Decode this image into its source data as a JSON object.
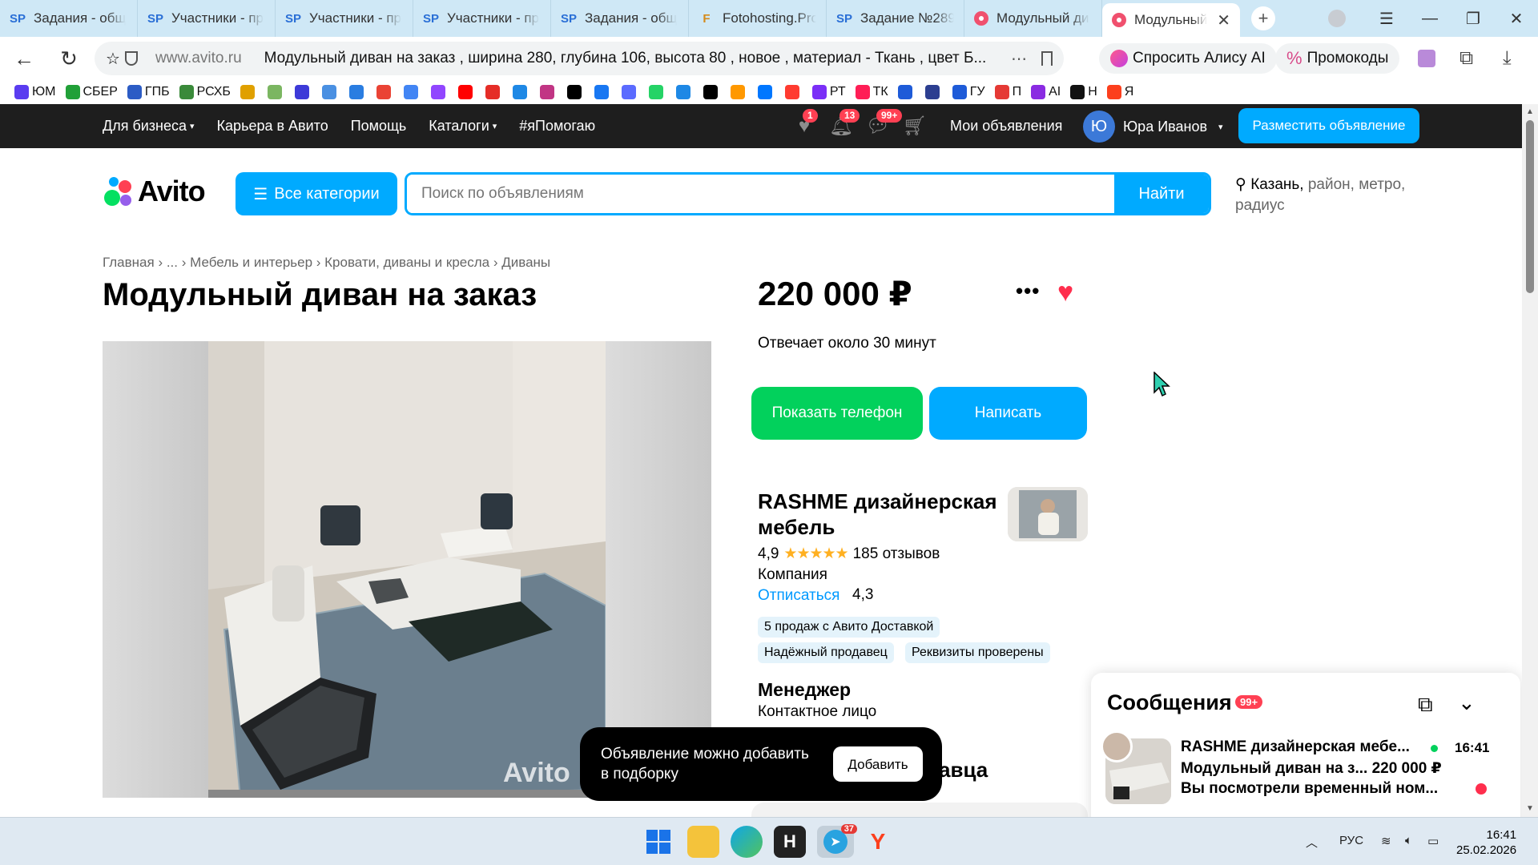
{
  "browser": {
    "tabs": [
      {
        "icon": "SP",
        "label": "Задания - общ"
      },
      {
        "icon": "SP",
        "label": "Участники - пр"
      },
      {
        "icon": "SP",
        "label": "Участники - пр"
      },
      {
        "icon": "SP",
        "label": "Участники - пр"
      },
      {
        "icon": "SP",
        "label": "Задания - общ"
      },
      {
        "icon": "F",
        "label": "Fotohosting.Pro"
      },
      {
        "icon": "SP",
        "label": "Задание №289"
      },
      {
        "icon": "",
        "label": "Модульный ди"
      },
      {
        "icon": "",
        "label": "Модульный"
      }
    ],
    "address": {
      "rating": "4,3",
      "host": "www.avito.ru",
      "page_title": "Модульный диван на заказ , ширина 280, глубина 106, высота 80 , новое , материал - Ткань , цвет Б..."
    },
    "alice_label": "Спросить Алису AI",
    "promo_label": "Промокоды",
    "bookmarks": [
      {
        "label": "ЮМ",
        "color": "#5a3cf0"
      },
      {
        "label": "СБЕР",
        "color": "#21a038"
      },
      {
        "label": "ГПБ",
        "color": "#2c5cc5"
      },
      {
        "label": "РСХБ",
        "color": "#3a8a3a"
      },
      {
        "label": "",
        "color": "#e0a000"
      },
      {
        "label": "",
        "color": "#7bb661"
      },
      {
        "label": "",
        "color": "#3d3ad8"
      },
      {
        "label": "",
        "color": "#4a90e2"
      },
      {
        "label": "",
        "color": "#2a7de1"
      },
      {
        "label": "",
        "color": "#ea4335"
      },
      {
        "label": "",
        "color": "#4285f4"
      },
      {
        "label": "",
        "color": "#9146ff"
      },
      {
        "label": "",
        "color": "#ff0000"
      },
      {
        "label": "",
        "color": "#e52d27"
      },
      {
        "label": "",
        "color": "#1e88e5"
      },
      {
        "label": "",
        "color": "#c13584"
      },
      {
        "label": "",
        "color": "#000000"
      },
      {
        "label": "",
        "color": "#1877f2"
      },
      {
        "label": "",
        "color": "#5b6bff"
      },
      {
        "label": "",
        "color": "#25d366"
      },
      {
        "label": "",
        "color": "#1e88e5"
      },
      {
        "label": "",
        "color": "#000000"
      },
      {
        "label": "",
        "color": "#ff9800"
      },
      {
        "label": "",
        "color": "#0077ff"
      },
      {
        "label": "",
        "color": "#ff3b30"
      },
      {
        "label": "РТ",
        "color": "#7b2ff7"
      },
      {
        "label": "ТК",
        "color": "#ff1e56"
      },
      {
        "label": "",
        "color": "#1e5bd8"
      },
      {
        "label": "",
        "color": "#2c3e90"
      },
      {
        "label": "ГУ",
        "color": "#1e5bd8"
      },
      {
        "label": "П",
        "color": "#e53935"
      },
      {
        "label": "AI",
        "color": "#8a2be2"
      },
      {
        "label": "Н",
        "color": "#111111"
      },
      {
        "label": "Я",
        "color": "#fc3f1d"
      }
    ]
  },
  "avito": {
    "topnav": {
      "links": [
        "Для бизнеса",
        "Карьера в Авито",
        "Помощь",
        "Каталоги",
        "#яПомогаю"
      ],
      "favorites_count": "1",
      "notifications_count": "13",
      "messages_count": "99+",
      "my_ads": "Мои объявления",
      "user_initial": "Ю",
      "user_name": "Юра Иванов",
      "post_button": "Разместить объявление"
    },
    "logo": "Avito",
    "all_categories": "Все категории",
    "search_placeholder": "Поиск по объявлениям",
    "search_button": "Найти",
    "location": {
      "city": "Казань,",
      "rest": "район, метро, радиус"
    },
    "breadcrumbs": [
      "Главная",
      "...",
      "Мебель и интерьер",
      "Кровати, диваны и кресла",
      "Диваны"
    ],
    "title": "Модульный диван на заказ",
    "price": "220 000 ₽",
    "response_time": "Отвечает около 30 минут",
    "show_phone": "Показать телефон",
    "write": "Написать",
    "seller": {
      "name": "RASHME дизайнерская мебель",
      "rating": "4,9",
      "stars": "★★★★★",
      "reviews": "185 отзывов",
      "type": "Компания",
      "unsubscribe": "Отписаться",
      "chips": [
        "5 продаж с Авито Доставкой",
        "Надёжный продавец",
        "Реквизиты проверены"
      ],
      "manager_title": "Менеджер",
      "manager_sub": "Контактное лицо",
      "section_fragment": "авца"
    },
    "watermark": "Avito",
    "toast": {
      "text": "Объявление можно добавить в подборку",
      "button": "Добавить"
    },
    "messages": {
      "title": "Сообщения",
      "count": "99+",
      "chat_name": "RASHME дизайнерская мебе...",
      "chat_time": "16:41",
      "chat_ad": "Модульный диван на з...  220 000 ₽",
      "chat_preview": "Вы посмотрели временный ном..."
    }
  },
  "taskbar": {
    "lang": "РУС",
    "time": "16:41",
    "date": "25.02.2026",
    "telegram_badge": "37"
  }
}
